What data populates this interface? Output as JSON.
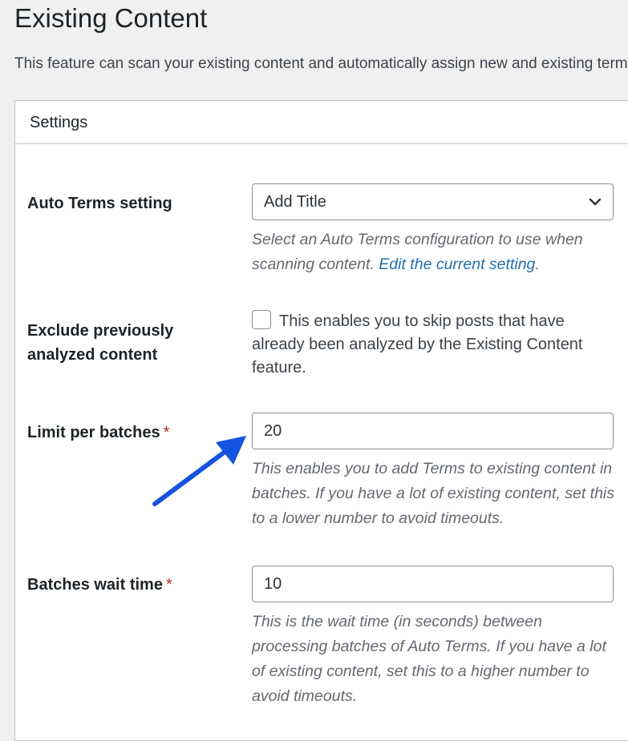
{
  "page": {
    "title": "Existing Content",
    "description": "This feature can scan your existing content and automatically assign new and existing terms"
  },
  "settings": {
    "header": "Settings",
    "auto_terms": {
      "label": "Auto Terms setting",
      "selected": "Add Title",
      "help_text": "Select an Auto Terms configuration to use when scanning content.",
      "help_link": "Edit the current setting",
      "help_suffix": "."
    },
    "exclude": {
      "label_line1": "Exclude previously",
      "label_line2": "analyzed content",
      "checked": false,
      "text": "This enables you to skip posts that have already been analyzed by the Existing Content feature."
    },
    "limit": {
      "label": "Limit per batches",
      "required_mark": "*",
      "value": "20",
      "help": "This enables you to add Terms to existing content in batches. If you have a lot of existing content, set this to a lower number to avoid timeouts."
    },
    "wait": {
      "label": "Batches wait time",
      "required_mark": "*",
      "value": "10",
      "help": "This is the wait time (in seconds) between processing batches of Auto Terms. If you have a lot of existing content, set this to a higher number to avoid timeouts."
    }
  },
  "colors": {
    "accent_link": "#2271b1",
    "annotation_arrow": "#1453e0",
    "required": "#b32d2e"
  },
  "icons": {
    "select_chevron": "chevron-down-icon",
    "annotation": "arrow-annotation-icon"
  }
}
